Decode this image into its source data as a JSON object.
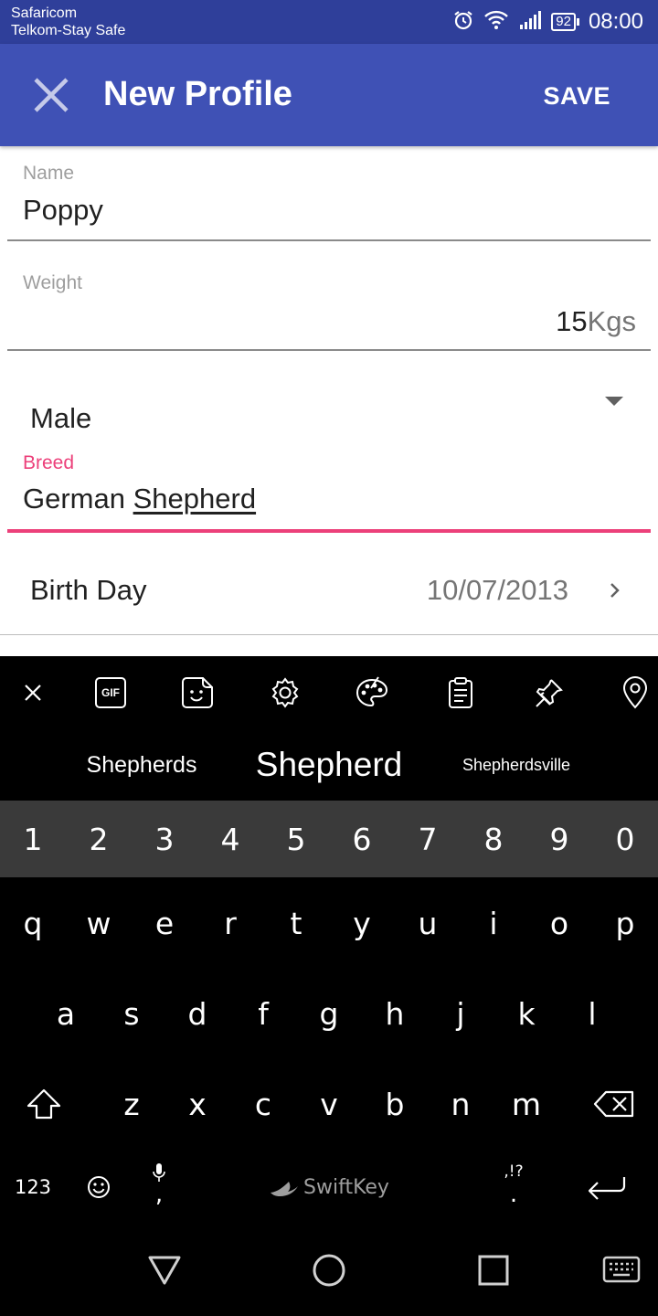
{
  "status_bar": {
    "carrier_1": "Safaricom",
    "carrier_2": "Telkom-Stay Safe",
    "battery": "92",
    "time": "08:00"
  },
  "app_bar": {
    "title": "New Profile",
    "save_label": "SAVE",
    "color": "#3f51b5"
  },
  "form": {
    "name_label": "Name",
    "name_value": "Poppy",
    "weight_label": "Weight",
    "weight_value": "15",
    "weight_unit": "Kgs",
    "gender_selected": "Male",
    "breed_label": "Breed",
    "breed_value_part1": "German ",
    "breed_value_part2": "Shepherd",
    "breed_accent": "#ec407a",
    "birthday_label": "Birth Day",
    "birthday_value": "10/07/2013"
  },
  "keyboard": {
    "toolbar_icons": [
      "close-icon",
      "gif-icon",
      "sticker-icon",
      "settings-icon",
      "theme-palette-icon",
      "clipboard-icon",
      "pin-icon",
      "location-icon"
    ],
    "gif_label": "GIF",
    "suggestions": [
      "Shepherds",
      "Shepherd",
      "Shepherdsville"
    ],
    "number_row": [
      "1",
      "2",
      "3",
      "4",
      "5",
      "6",
      "7",
      "8",
      "9",
      "0"
    ],
    "row1": [
      "q",
      "w",
      "e",
      "r",
      "t",
      "y",
      "u",
      "i",
      "o",
      "p"
    ],
    "row2": [
      "a",
      "s",
      "d",
      "f",
      "g",
      "h",
      "j",
      "k",
      "l"
    ],
    "row3": [
      "z",
      "x",
      "c",
      "v",
      "b",
      "n",
      "m"
    ],
    "symbols_label": "123",
    "comma_label": ",",
    "punct_hint": ",!?",
    "period_label": ".",
    "brand": "SwiftKey"
  }
}
